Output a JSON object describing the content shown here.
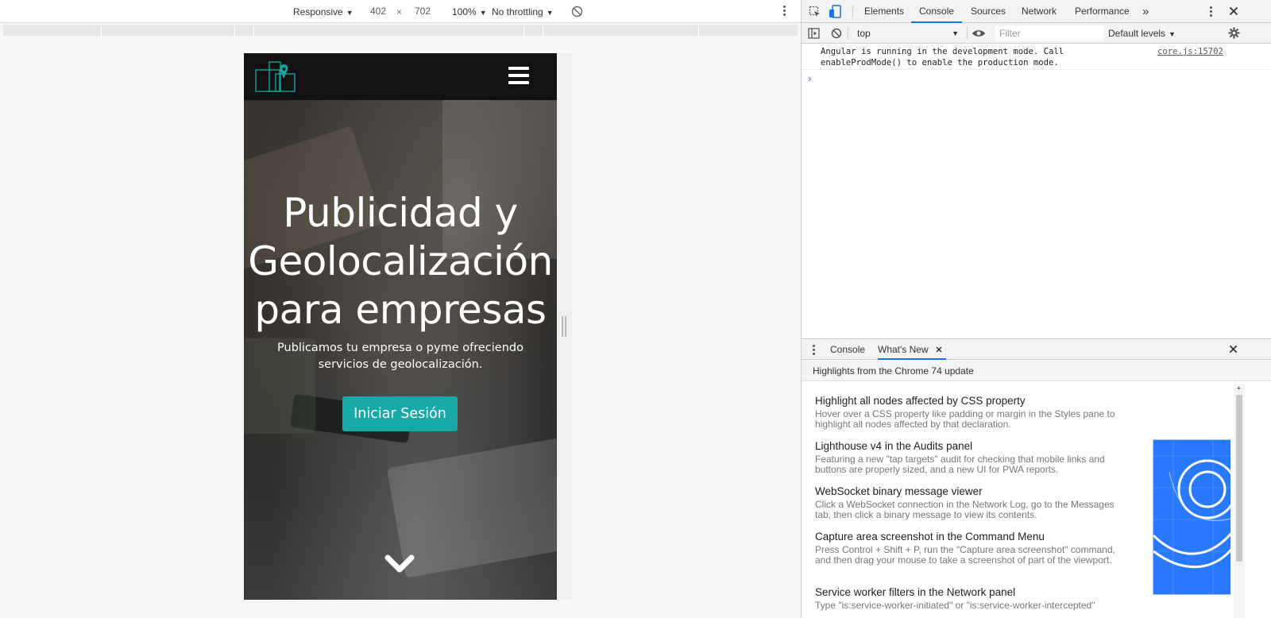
{
  "device_toolbar": {
    "device": "Responsive",
    "width": "402",
    "times": "×",
    "height": "702",
    "zoom": "100%",
    "throttling": "No throttling"
  },
  "site": {
    "hero_title_lines": [
      "Publicidad y",
      "Geolocalización",
      "para empresas"
    ],
    "hero_subtitle": "Publicamos tu empresa o pyme ofreciendo servicios de geolocalización.",
    "login_button": "Iniciar Sesión",
    "accent_color": "#17a9a5"
  },
  "devtools": {
    "tabs": [
      "Elements",
      "Console",
      "Sources",
      "Network",
      "Performance"
    ],
    "active_tab": "Console",
    "more_tabs": "»",
    "context": "top",
    "filter_placeholder": "Filter",
    "levels": "Default levels",
    "console_message": "Angular is running in the development mode. Call\nenableProdMode() to enable the production mode.",
    "console_source": "core.js:15702",
    "prompt": "›"
  },
  "drawer": {
    "tabs": [
      "Console",
      "What's New"
    ],
    "active_tab": "What's New",
    "header": "Highlights from the Chrome 74 update",
    "items": [
      {
        "title": "Highlight all nodes affected by CSS property",
        "desc": "Hover over a CSS property like padding or margin in the Styles pane to highlight all nodes affected by that declaration."
      },
      {
        "title": "Lighthouse v4 in the Audits panel",
        "desc": "Featuring a new \"tap targets\" audit for checking that mobile links and buttons are properly sized, and a new UI for PWA reports."
      },
      {
        "title": "WebSocket binary message viewer",
        "desc": "Click a WebSocket connection in the Network Log, go to the Messages tab, then click a binary message to view its contents."
      },
      {
        "title": "Capture area screenshot in the Command Menu",
        "desc": "Press Control + Shift + P, run the \"Capture area screenshot\" command, and then drag your mouse to take a screenshot of part of the viewport."
      },
      {
        "title": "Service worker filters in the Network panel",
        "desc": "Type \"is:service-worker-initiated\" or \"is:service-worker-intercepted\""
      }
    ]
  }
}
